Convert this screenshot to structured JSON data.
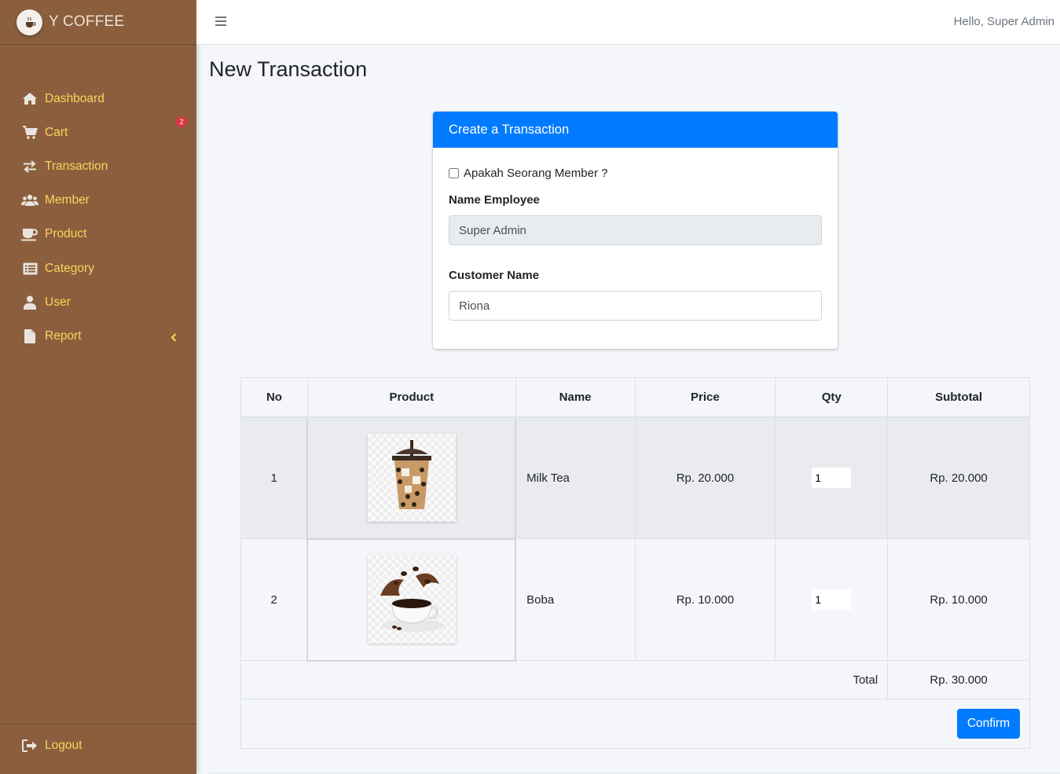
{
  "brand": {
    "title": "Y COFFEE",
    "logo_icon": "coffee-cup-logo"
  },
  "sidebar": {
    "items": [
      {
        "label": "Dashboard",
        "icon": "home-icon"
      },
      {
        "label": "Cart",
        "icon": "cart-icon",
        "badge": "2"
      },
      {
        "label": "Transaction",
        "icon": "exchange-icon"
      },
      {
        "label": "Member",
        "icon": "users-icon"
      },
      {
        "label": "Product",
        "icon": "mug-icon"
      },
      {
        "label": "Category",
        "icon": "list-icon"
      },
      {
        "label": "User",
        "icon": "user-icon"
      },
      {
        "label": "Report",
        "icon": "file-icon"
      }
    ],
    "logout": "Logout"
  },
  "topbar": {
    "greeting": "Hello, Super Admin"
  },
  "page": {
    "title": "New Transaction"
  },
  "form": {
    "header": "Create a Transaction",
    "member_check_label": "Apakah Seorang Member ?",
    "employee_label": "Name Employee",
    "employee_value": "Super Admin",
    "customer_label": "Customer Name",
    "customer_value": "Riona"
  },
  "table": {
    "headers": [
      "No",
      "Product",
      "Name",
      "Price",
      "Qty",
      "Subtotal"
    ],
    "rows": [
      {
        "no": "1",
        "image": "milk-tea-image",
        "name": "Milk Tea",
        "price": "Rp. 20.000",
        "qty": "1",
        "subtotal": "Rp. 20.000"
      },
      {
        "no": "2",
        "image": "coffee-cup-image",
        "name": "Boba",
        "price": "Rp. 10.000",
        "qty": "1",
        "subtotal": "Rp. 10.000"
      }
    ],
    "total_label": "Total",
    "total_value": "Rp. 30.000",
    "confirm_label": "Confirm"
  },
  "colors": {
    "sidebar_bg": "#8b5f3e",
    "nav_text": "#ffd25a",
    "primary": "#007bff",
    "badge": "#dc3545"
  }
}
